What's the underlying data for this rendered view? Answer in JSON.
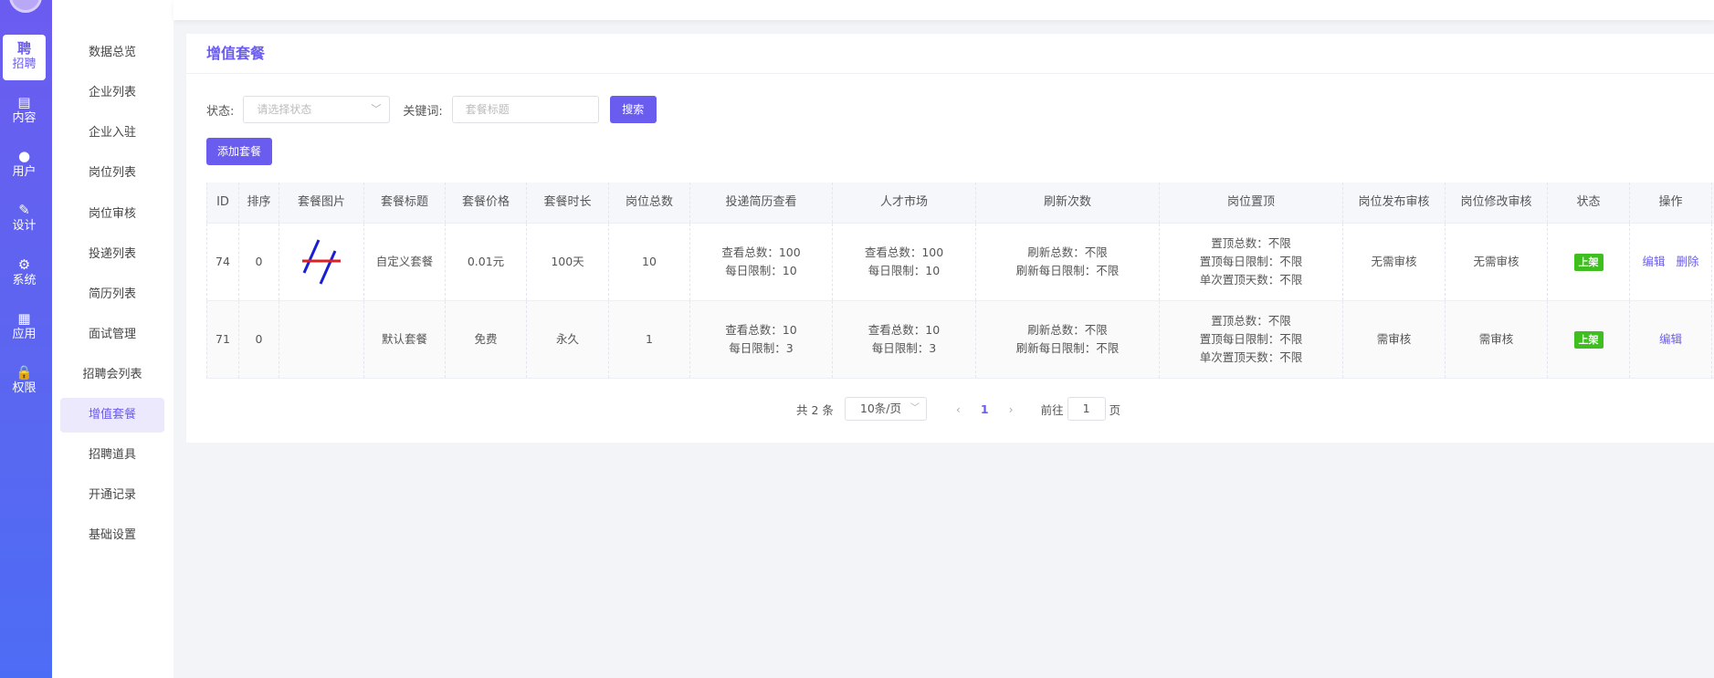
{
  "iconbar": {
    "items": [
      {
        "glyph": "聘",
        "label": "招聘",
        "icon": "recruit-icon"
      },
      {
        "glyph": "▤",
        "label": "内容",
        "icon": "document-icon"
      },
      {
        "glyph": "●",
        "label": "用户",
        "icon": "user-icon"
      },
      {
        "glyph": "✎",
        "label": "设计",
        "icon": "brush-icon"
      },
      {
        "glyph": "⚙",
        "label": "系统",
        "icon": "gear-icon"
      },
      {
        "glyph": "▦",
        "label": "应用",
        "icon": "apps-icon"
      },
      {
        "glyph": "🔒",
        "label": "权限",
        "icon": "lock-icon"
      }
    ]
  },
  "submenu": {
    "items": [
      "数据总览",
      "企业列表",
      "企业入驻",
      "岗位列表",
      "岗位审核",
      "投递列表",
      "简历列表",
      "面试管理",
      "招聘会列表",
      "增值套餐",
      "招聘道具",
      "开通记录",
      "基础设置"
    ],
    "active": "增值套餐"
  },
  "card": {
    "title": "增值套餐"
  },
  "filters": {
    "status_label": "状态:",
    "status_placeholder": "请选择状态",
    "keyword_label": "关键词:",
    "keyword_placeholder": "套餐标题",
    "search_label": "搜索",
    "add_label": "添加套餐"
  },
  "table": {
    "headers": [
      "ID",
      "排序",
      "套餐图片",
      "套餐标题",
      "套餐价格",
      "套餐时长",
      "岗位总数",
      "投递简历查看",
      "人才市场",
      "刷新次数",
      "岗位置顶",
      "岗位发布审核",
      "岗位修改审核",
      "状态",
      "操作"
    ],
    "rows": [
      {
        "id": "74",
        "sort": "0",
        "title": "自定义套餐",
        "price": "0.01元",
        "duration": "100天",
        "jobs": "10",
        "resume": [
          "查看总数：100",
          "每日限制：10"
        ],
        "talent": [
          "查看总数：100",
          "每日限制：10"
        ],
        "refresh": [
          "刷新总数：不限",
          "刷新每日限制：不限"
        ],
        "top": [
          "置顶总数：不限",
          "置顶每日限制：不限",
          "单次置顶天数：不限"
        ],
        "publish_review": "无需审核",
        "modify_review": "无需审核",
        "status": "上架",
        "actions": [
          "编辑",
          "删除"
        ]
      },
      {
        "id": "71",
        "sort": "0",
        "title": "默认套餐",
        "price": "免费",
        "duration": "永久",
        "jobs": "1",
        "resume": [
          "查看总数：10",
          "每日限制：3"
        ],
        "talent": [
          "查看总数：10",
          "每日限制：3"
        ],
        "refresh": [
          "刷新总数：不限",
          "刷新每日限制：不限"
        ],
        "top": [
          "置顶总数：不限",
          "置顶每日限制：不限",
          "单次置顶天数：不限"
        ],
        "publish_review": "需审核",
        "modify_review": "需审核",
        "status": "上架",
        "actions": [
          "编辑"
        ]
      }
    ]
  },
  "pager": {
    "total": "共 2 条",
    "size": "10条/页",
    "current": "1",
    "goto_label": "前往",
    "goto_value": "1",
    "page_suffix": "页"
  },
  "colors": {
    "accent": "#6b5cf0",
    "status_green": "#3fbf1f"
  }
}
